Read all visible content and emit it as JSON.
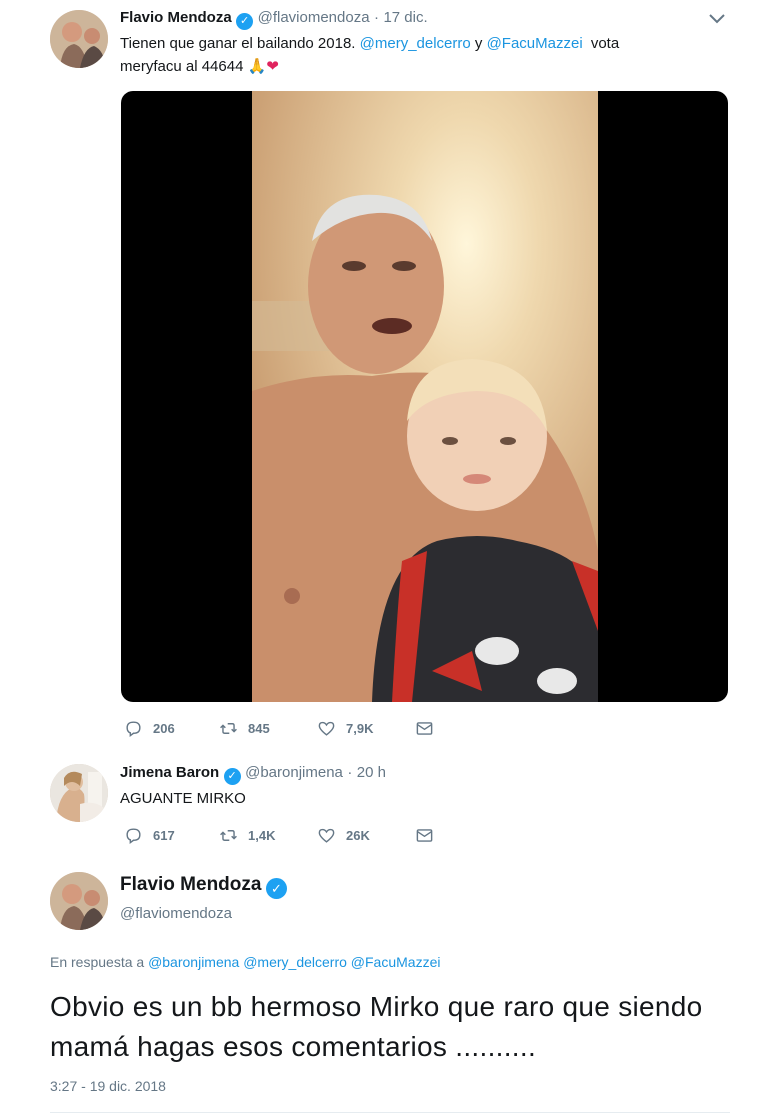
{
  "tweet1": {
    "name": "Flavio Mendoza",
    "handle": "@flaviomendoza",
    "separator": "·",
    "time": "17 dic.",
    "text_part1": "Tienen que ganar el bailando 2018.",
    "mention1": "@mery_delcerro",
    "conjunction": "y",
    "mention2": "@FacuMazzei",
    "text_part2": "vota",
    "text_line2": "meryfacu al 44644",
    "emoji": "🙏❤",
    "replies": "206",
    "retweets": "845",
    "likes": "7,9K"
  },
  "tweet2": {
    "name": "Jimena Baron",
    "handle": "@baronjimena",
    "separator": "·",
    "time": "20 h",
    "text": "AGUANTE MIRKO",
    "replies": "617",
    "retweets": "1,4K",
    "likes": "26K"
  },
  "tweet3": {
    "name": "Flavio Mendoza",
    "handle": "@flaviomendoza",
    "reply_prefix": "En respuesta a",
    "reply_mentions": [
      "@baronjimena",
      "@mery_delcerro",
      "@FacuMazzei"
    ],
    "text": "Obvio es un bb hermoso Mirko que raro que siendo mamá hagas esos comentarios ..........",
    "timestamp": "3:27 - 19 dic. 2018"
  },
  "icons": {
    "reply": "reply-icon",
    "retweet": "retweet-icon",
    "like": "heart-icon",
    "dm": "envelope-icon",
    "verified": "verified-badge-icon",
    "more": "chevron-down-icon"
  },
  "colors": {
    "link": "#1b95e0",
    "muted": "#657786",
    "verified": "#1da1f2",
    "text": "#14171a"
  }
}
